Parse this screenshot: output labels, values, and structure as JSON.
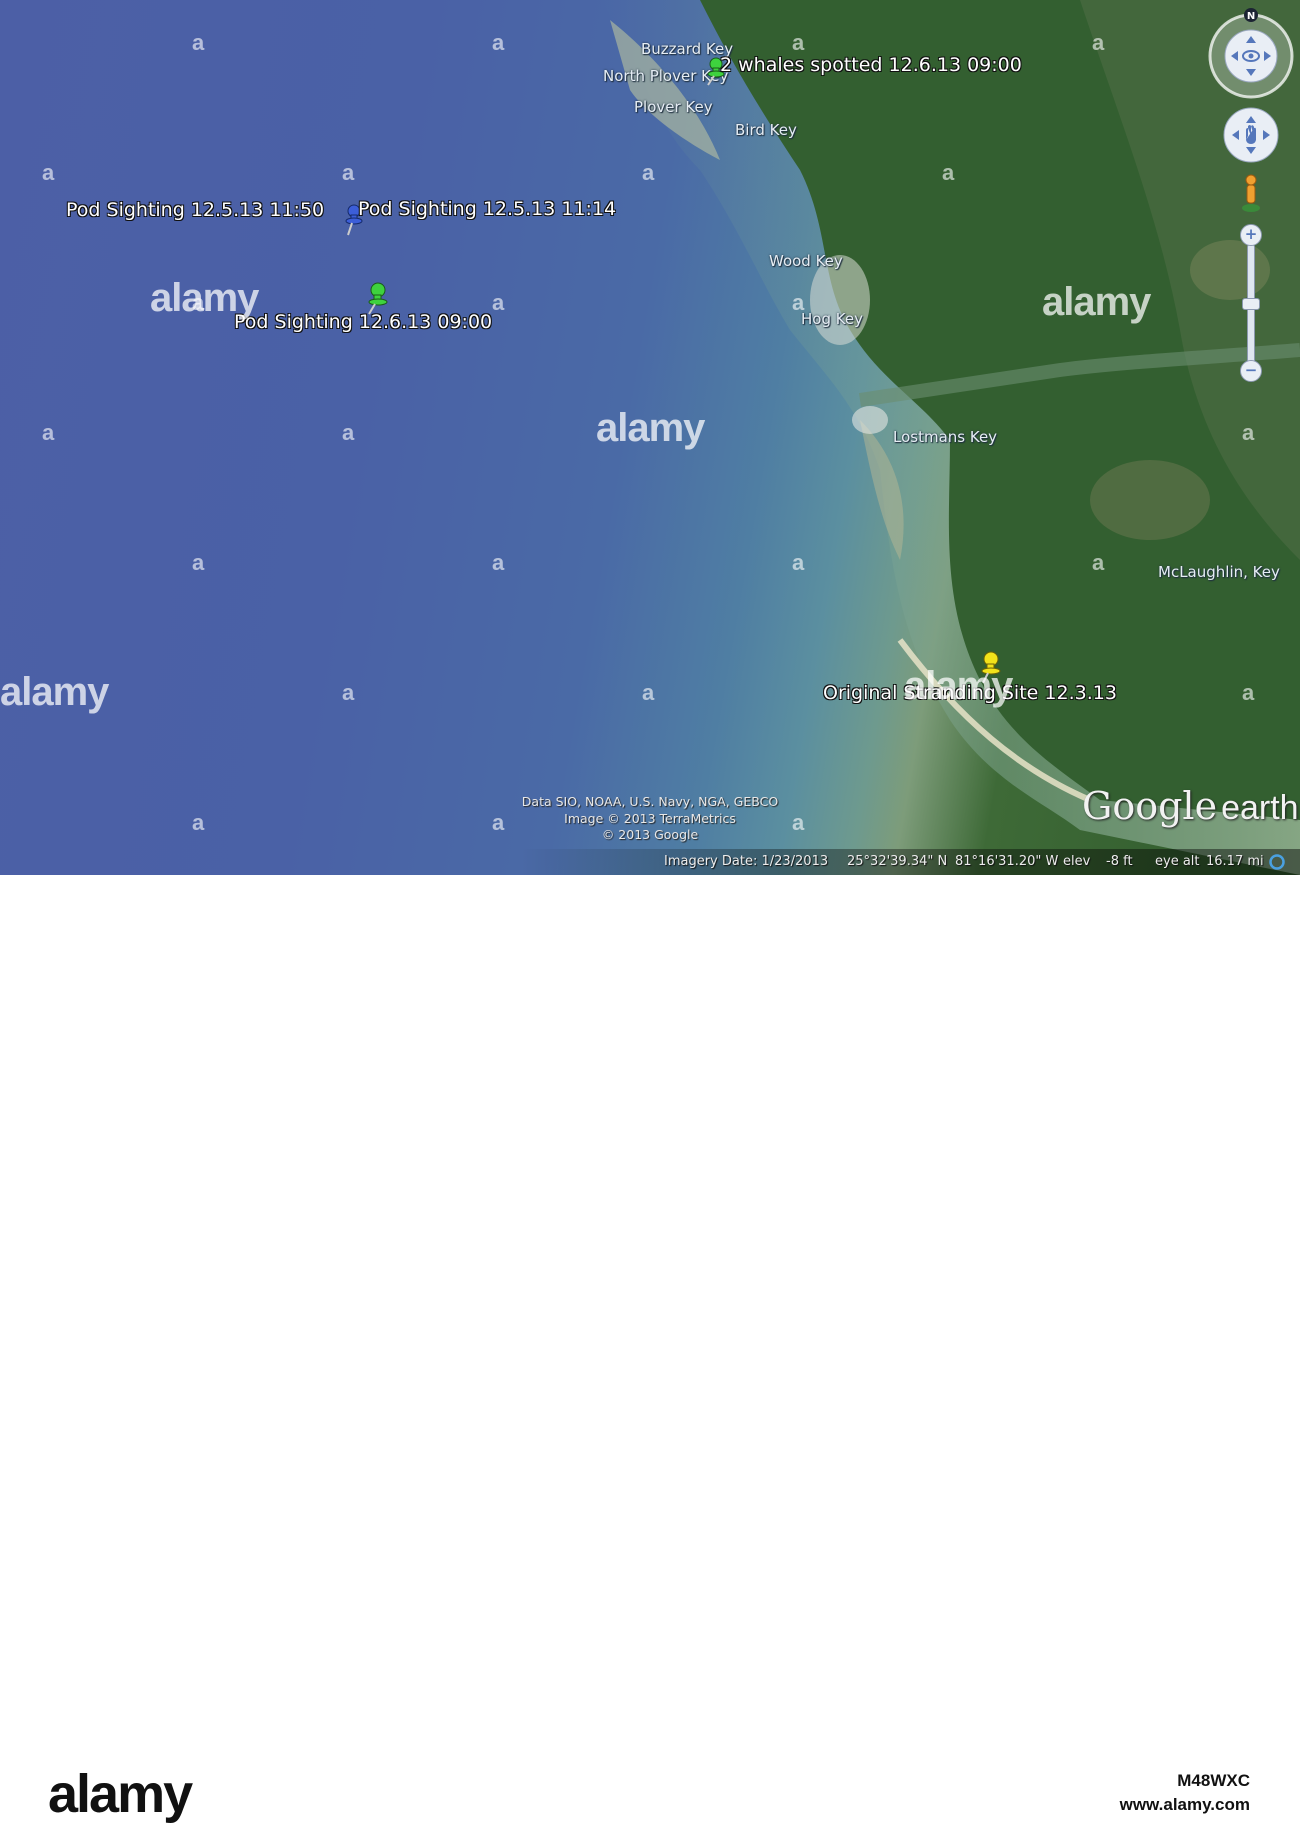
{
  "place_labels": {
    "buzzard_key": "Buzzard Key",
    "north_plover_key": "North Plover Key",
    "plover_key": "Plover Key",
    "bird_key": "Bird Key",
    "wood_key": "Wood Key",
    "hog_key": "Hog Key",
    "lostmans_key": "Lostmans Key",
    "mclaughlin_key": "McLaughlin, Key"
  },
  "placemarks": {
    "whales_spotted": "2 whales spotted 12.6.13 09:00",
    "pod_1150": "Pod Sighting 12.5.13 11:50",
    "pod_1114": "Pod Sighting 12.5.13 11:14",
    "pod_0900": "Pod Sighting 12.6.13 09:00",
    "stranding": "Original Stranding Site 12.3.13"
  },
  "pin_colors": {
    "green": "#3ed23e",
    "blue": "#3c5ed8",
    "yellow": "#f2e21a"
  },
  "credits": {
    "line1": "Data SIO, NOAA, U.S. Navy, NGA, GEBCO",
    "line2": "Image © 2013 TerraMetrics",
    "line3": "© 2013 Google"
  },
  "status": {
    "imagery_date": "Imagery Date: 1/23/2013",
    "latitude": "25°32'39.34\" N",
    "longitude": "81°16'31.20\" W",
    "elev_label": "elev",
    "elev_value": "-8 ft",
    "eye_alt_label": "eye alt",
    "eye_alt_value": "16.17 mi"
  },
  "logo": {
    "google": "Google",
    "earth": "earth"
  },
  "controls": {
    "north": "N"
  },
  "watermark": {
    "word": "alamy",
    "letter": "a"
  },
  "footer": {
    "logo": "alamy",
    "image_id": "M48WXC",
    "site": "www.alamy.com"
  }
}
